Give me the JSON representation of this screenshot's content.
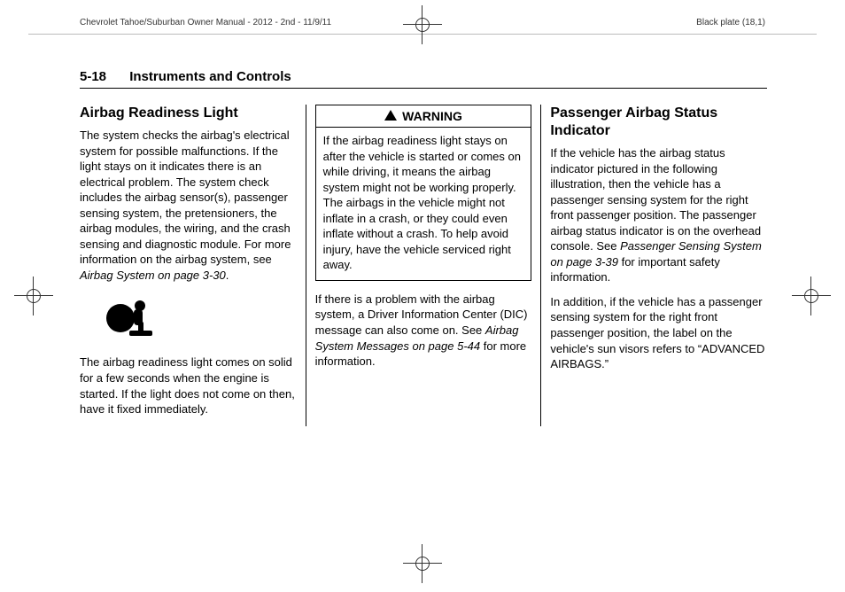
{
  "trim": {
    "left": "Chevrolet Tahoe/Suburban Owner Manual - 2012 - 2nd - 11/9/11",
    "right": "Black plate (18,1)"
  },
  "header": {
    "page_number": "5-18",
    "section_title": "Instruments and Controls"
  },
  "col1": {
    "heading": "Airbag Readiness Light",
    "p1_a": "The system checks the airbag's electrical system for possible malfunctions. If the light stays on it indicates there is an electrical problem. The system check includes the airbag sensor(s), passenger sensing system, the pretensioners, the airbag modules, the wiring, and the crash sensing and diagnostic module. For more information on the airbag system, see ",
    "p1_ref": "Airbag System on page 3-30",
    "p1_c": ".",
    "p2": "The airbag readiness light comes on solid for a few seconds when the engine is started. If the light does not come on then, have it fixed immediately."
  },
  "col2": {
    "warning_label": "WARNING",
    "warning_text": "If the airbag readiness light stays on after the vehicle is started or comes on while driving, it means the airbag system might not be working properly. The airbags in the vehicle might not inflate in a crash, or they could even inflate without a crash. To help avoid injury, have the vehicle serviced right away.",
    "p1_a": "If there is a problem with the airbag system, a Driver Information Center (DIC) message can also come on. See ",
    "p1_ref": "Airbag System Messages on page 5-44",
    "p1_c": " for more information."
  },
  "col3": {
    "heading": "Passenger Airbag Status Indicator",
    "p1_a": "If the vehicle has the airbag status indicator pictured in the following illustration, then the vehicle has a passenger sensing system for the right front passenger position. The passenger airbag status indicator is on the overhead console. See ",
    "p1_ref": "Passenger Sensing System on page 3-39",
    "p1_c": " for important safety information.",
    "p2": "In addition, if the vehicle has a passenger sensing system for the right front passenger position, the label on the vehicle's sun visors refers to “ADVANCED AIRBAGS.”"
  }
}
